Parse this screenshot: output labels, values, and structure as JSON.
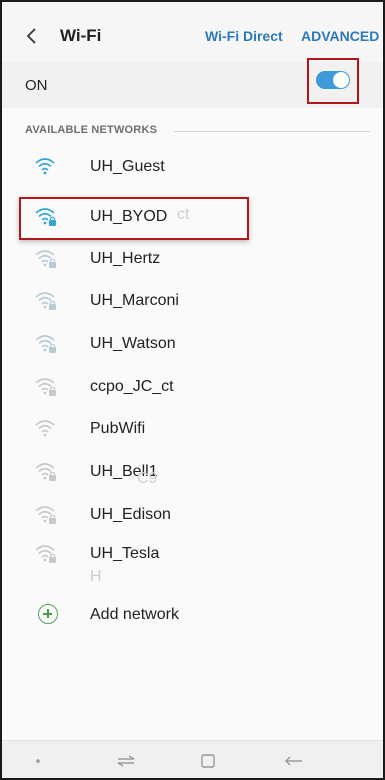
{
  "header": {
    "title": "Wi-Fi",
    "wifi_direct": "Wi-Fi Direct",
    "advanced": "ADVANCED"
  },
  "toggle": {
    "label": "ON",
    "state": "on",
    "color": "#3e9bd8"
  },
  "section": {
    "available": "AVAILABLE NETWORKS"
  },
  "networks": [
    {
      "name": "UH_Guest",
      "secured": false,
      "signal": "strong"
    },
    {
      "name": "UH_BYOD",
      "secured": true,
      "signal": "strong",
      "highlighted": true
    },
    {
      "name": "UH_Hertz",
      "secured": true,
      "signal": "medium"
    },
    {
      "name": "UH_Marconi",
      "secured": true,
      "signal": "medium"
    },
    {
      "name": "UH_Watson",
      "secured": true,
      "signal": "medium"
    },
    {
      "name": "ccpo_JC_ct",
      "secured": true,
      "signal": "weak"
    },
    {
      "name": "PubWifi",
      "secured": false,
      "signal": "weak"
    },
    {
      "name": "UH_Bell1",
      "secured": true,
      "signal": "weak"
    },
    {
      "name": "UH_Edison",
      "secured": true,
      "signal": "weak"
    },
    {
      "name": "UH_Tesla",
      "secured": true,
      "signal": "weak"
    }
  ],
  "add_network": "Add network",
  "nav": {
    "icons": [
      "dot-icon",
      "recents-icon",
      "home-icon",
      "back-icon"
    ]
  },
  "colors": {
    "accent": "#2e7ab8",
    "highlight_border": "#b0181b",
    "wifi_strong": "#34a6d6",
    "wifi_weak": "#c8c8c8"
  }
}
